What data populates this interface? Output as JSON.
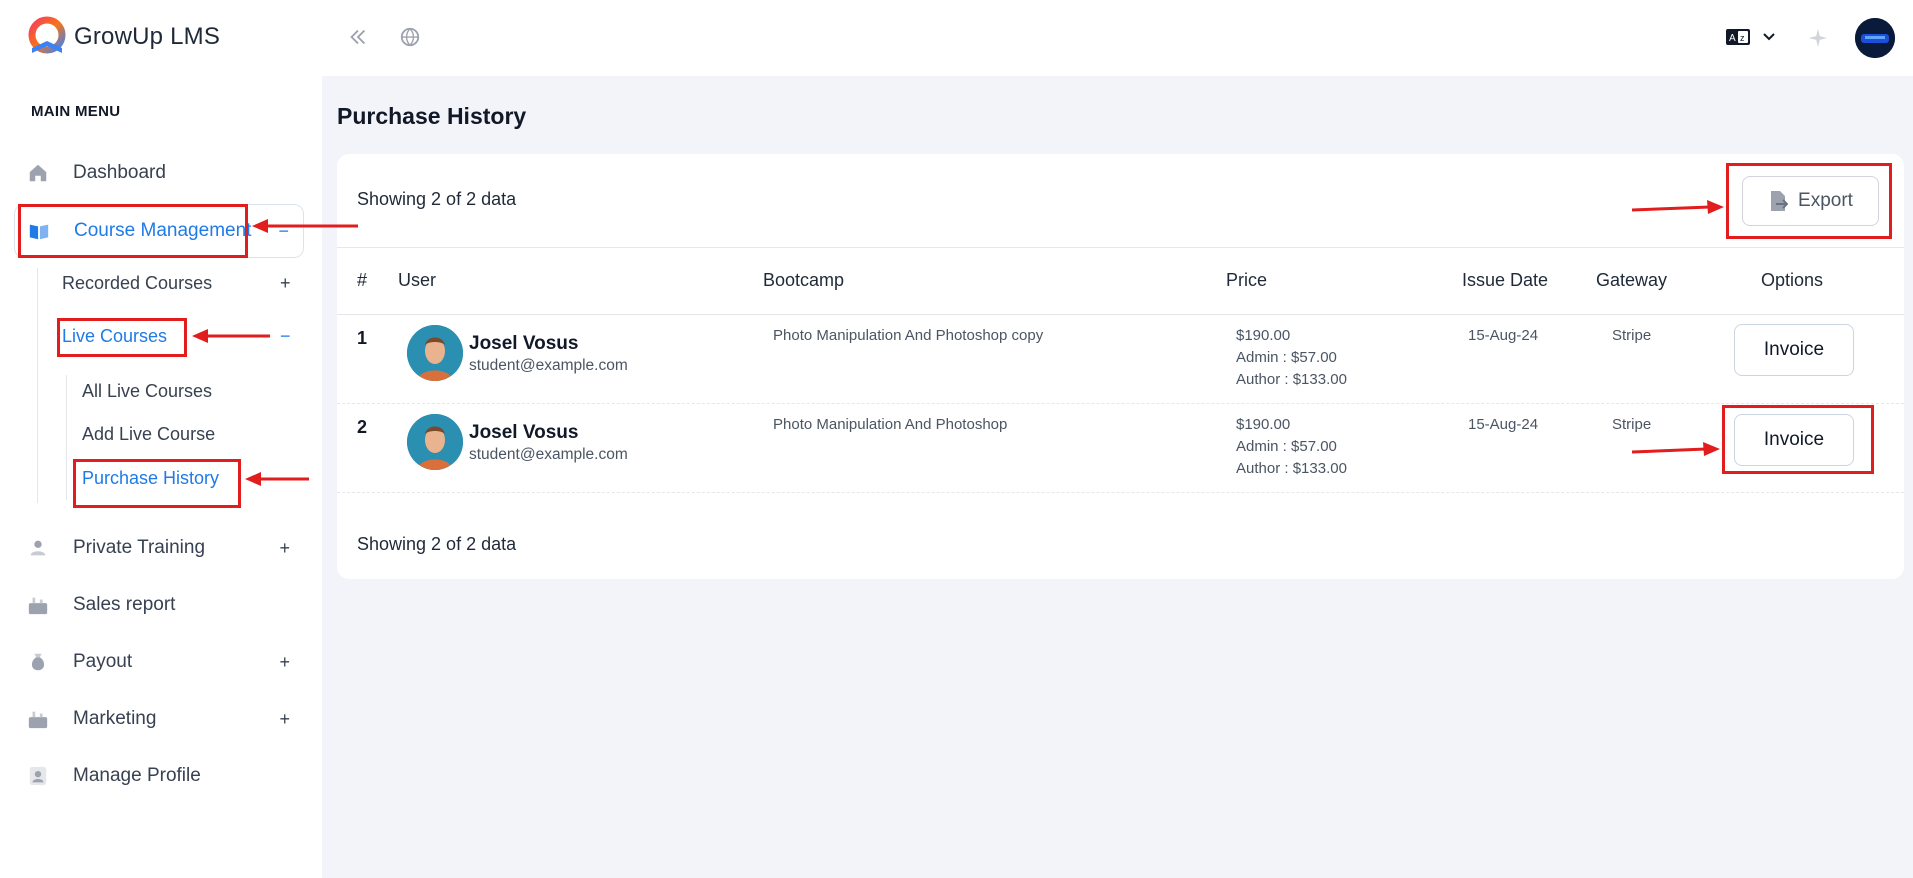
{
  "app": {
    "name": "GrowUp LMS"
  },
  "sidebar": {
    "heading": "MAIN MENU",
    "items": [
      {
        "label": "Dashboard",
        "icon": "home-icon"
      },
      {
        "label": "Course Management",
        "icon": "book-icon",
        "toggle": "−"
      },
      {
        "label": "Private Training",
        "icon": "users-icon",
        "toggle": "+"
      },
      {
        "label": "Sales report",
        "icon": "chart-icon"
      },
      {
        "label": "Payout",
        "icon": "money-bag-icon",
        "toggle": "+"
      },
      {
        "label": "Marketing",
        "icon": "chart-icon",
        "toggle": "+"
      },
      {
        "label": "Manage Profile",
        "icon": "profile-icon"
      }
    ],
    "course_sub": {
      "recorded": {
        "label": "Recorded Courses",
        "toggle": "+"
      },
      "live": {
        "label": "Live Courses",
        "toggle": "−"
      },
      "live_sub": [
        "All Live Courses",
        "Add Live Course",
        "Purchase History"
      ]
    }
  },
  "page": {
    "title": "Purchase History"
  },
  "table": {
    "showing_top": "Showing 2 of 2 data",
    "showing_bottom": "Showing 2 of 2 data",
    "export_label": "Export",
    "headers": [
      "#",
      "User",
      "Bootcamp",
      "Price",
      "Issue Date",
      "Gateway",
      "Options"
    ],
    "rows": [
      {
        "num": "1",
        "name": "Josel Vosus",
        "email": "student@example.com",
        "bootcamp": "Photo Manipulation And Photoshop copy",
        "price": "$190.00",
        "admin": "Admin : $57.00",
        "author": "Author : $133.00",
        "date": "15-Aug-24",
        "gateway": "Stripe",
        "option": "Invoice"
      },
      {
        "num": "2",
        "name": "Josel Vosus",
        "email": "student@example.com",
        "bootcamp": "Photo Manipulation And Photoshop",
        "price": "$190.00",
        "admin": "Admin : $57.00",
        "author": "Author : $133.00",
        "date": "15-Aug-24",
        "gateway": "Stripe",
        "option": "Invoice"
      }
    ]
  },
  "colors": {
    "accent": "#1e7be8",
    "annotation": "#e11d1d"
  }
}
